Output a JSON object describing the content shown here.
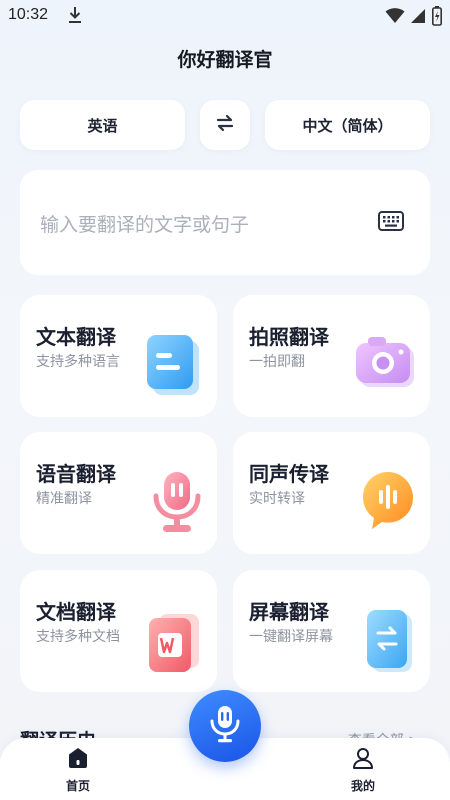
{
  "status": {
    "time": "10:32"
  },
  "app": {
    "title": "你好翻译官"
  },
  "languages": {
    "source": "英语",
    "target": "中文（简体）",
    "swap_icon": "swap-arrows-icon"
  },
  "input": {
    "placeholder": "输入要翻译的文字或句子",
    "keyboard_icon": "keyboard-icon"
  },
  "features": [
    {
      "title": "文本翻译",
      "subtitle": "支持多种语言",
      "icon": "text-document-icon"
    },
    {
      "title": "拍照翻译",
      "subtitle": "一拍即翻",
      "icon": "camera-icon"
    },
    {
      "title": "语音翻译",
      "subtitle": "精准翻译",
      "icon": "microphone-icon"
    },
    {
      "title": "同声传译",
      "subtitle": "实时转译",
      "icon": "voice-bubble-icon"
    },
    {
      "title": "文档翻译",
      "subtitle": "支持多种文档",
      "icon": "word-document-icon"
    },
    {
      "title": "屏幕翻译",
      "subtitle": "一键翻译屏幕",
      "icon": "phone-screen-icon"
    }
  ],
  "history": {
    "title": "翻译历史",
    "more": "查看全部 >"
  },
  "nav": {
    "home": "首页",
    "mine": "我的"
  },
  "colors": {
    "accent": "#2a6cf0",
    "background": "#f2f4f8"
  }
}
